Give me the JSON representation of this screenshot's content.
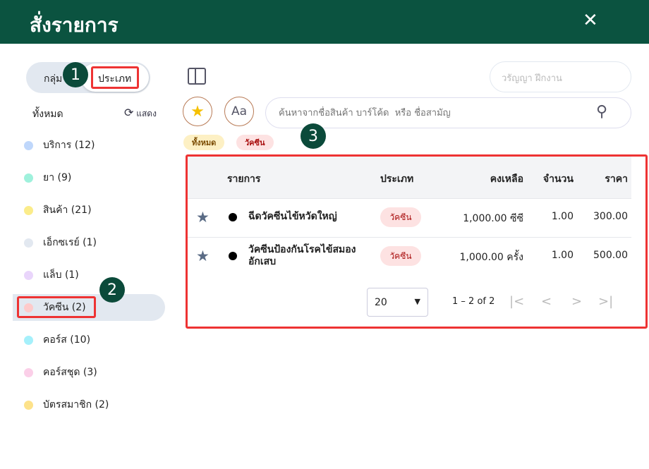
{
  "header": {
    "title": "สั่งรายการ",
    "close_icon": "close-icon"
  },
  "sidebar": {
    "toggle": {
      "group": "กลุ่ม",
      "type": "ประเภท"
    },
    "all_label": "ทั้งหมด",
    "show_label": "แสดง",
    "items": [
      {
        "label": "บริการ (12)",
        "color": "#bfd7fb"
      },
      {
        "label": "ยา (9)",
        "color": "#9ff1dc"
      },
      {
        "label": "สินค้า (21)",
        "color": "#fbec8a"
      },
      {
        "label": "เอ็กซเรย์ (1)",
        "color": "#e2e8f0"
      },
      {
        "label": "แล็บ (1)",
        "color": "#e9d5fb"
      },
      {
        "label": "วัคซีน (2)",
        "color": "#fecaca",
        "selected": true
      },
      {
        "label": "คอร์ส (10)",
        "color": "#a5f0fb"
      },
      {
        "label": "คอร์สชุด (3)",
        "color": "#fbcfe8"
      },
      {
        "label": "บัตรสมาชิก (2)",
        "color": "#fde28a"
      }
    ]
  },
  "main": {
    "user": "วรัญญา ฝึกงาน",
    "search_placeholder": "ค้นหาจากชื่อสินค้า บาร์โค้ด  หรือ ชื่อสามัญ",
    "font_button": "Aa",
    "chips": [
      "ทั้งหมด",
      "วัคซีน"
    ],
    "table": {
      "columns": [
        "รายการ",
        "ประเภท",
        "คงเหลือ",
        "จำนวน",
        "ราคา"
      ],
      "rows": [
        {
          "name": "ฉีดวัคซีนไข้หวัดใหญ่",
          "type": "วัคซีน",
          "remaining": "1,000.00 ซีซี",
          "qty": "1.00",
          "price": "300.00"
        },
        {
          "name": "วัคซีนป้องกันโรคไข้สมอง\nอักเสบ",
          "type": "วัคซีน",
          "remaining": "1,000.00 ครั้ง",
          "qty": "1.00",
          "price": "500.00"
        }
      ]
    },
    "pagination": {
      "page_size": "20",
      "range": "1 – 2 of 2"
    }
  },
  "annotations": [
    "1",
    "2",
    "3"
  ]
}
